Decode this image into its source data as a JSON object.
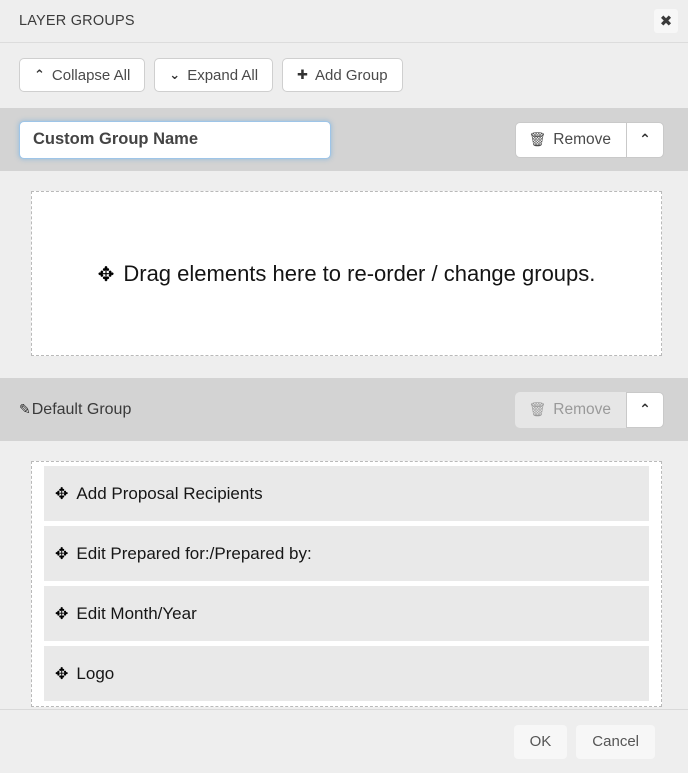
{
  "dialog": {
    "title": "LAYER GROUPS",
    "close_icon": "close-icon",
    "close_label": "✖"
  },
  "toolbar": {
    "buttons": [
      {
        "label": "Collapse All",
        "icon": "chevron-up-icon",
        "glyph": "⌃"
      },
      {
        "label": "Expand All",
        "icon": "chevron-down-icon",
        "glyph": "⌄"
      },
      {
        "label": "Add Group",
        "icon": "plus-icon",
        "glyph": "✚"
      }
    ]
  },
  "icons": {
    "move": "✥",
    "trash": "🗑",
    "pencil": "✎",
    "chevron_up": "⌃"
  },
  "groups": [
    {
      "id": "custom-group",
      "editing": true,
      "name_value": "Custom Group Name",
      "name_placeholder": "Group Name",
      "remove_label": "Remove",
      "remove_disabled": false,
      "collapse_label": "⌃",
      "empty_message": "Drag elements here to re-order / change groups.",
      "items": []
    },
    {
      "id": "default-group",
      "editing": false,
      "name_value": "Default Group",
      "remove_label": "Remove",
      "remove_disabled": true,
      "collapse_label": "⌃",
      "empty_message": "",
      "items": [
        {
          "label": "Add Proposal Recipients"
        },
        {
          "label": "Edit Prepared for:/Prepared by:"
        },
        {
          "label": "Edit Month/Year"
        },
        {
          "label": "Logo"
        }
      ]
    }
  ],
  "footer": {
    "ok_label": "OK",
    "cancel_label": "Cancel"
  },
  "colors": {
    "dialog_bg": "#eeeeee",
    "group_header_bg": "#d3d3d3",
    "item_bg": "#e9e9e9",
    "focus_border": "#9ec5e8",
    "button_bg": "#ffffff"
  }
}
